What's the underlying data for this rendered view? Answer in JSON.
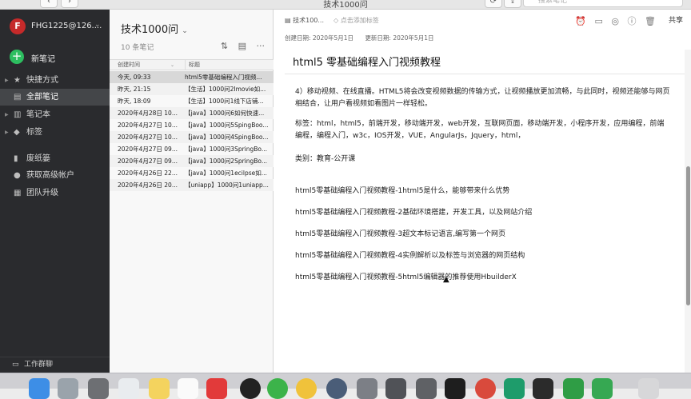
{
  "window": {
    "title": "技术1000问",
    "search_placeholder": "搜索笔记"
  },
  "sidebar": {
    "account": {
      "initial": "F",
      "name": "FHG1225@126...."
    },
    "new_note_label": "新笔记",
    "items": [
      {
        "label": "快捷方式",
        "icon": "star-icon"
      },
      {
        "label": "全部笔记",
        "icon": "note-icon",
        "active": true
      },
      {
        "label": "笔记本",
        "icon": "notebook-icon"
      },
      {
        "label": "标签",
        "icon": "tag-icon"
      },
      {
        "label": "废纸篓",
        "icon": "trash-icon"
      },
      {
        "label": "获取高级帐户",
        "icon": "upgrade-icon"
      },
      {
        "label": "团队升级",
        "icon": "team-icon"
      }
    ],
    "footer_label": "工作群聊"
  },
  "notes_list": {
    "title": "技术1000问",
    "count": "10 条笔记",
    "columns": {
      "created": "创建时间",
      "title": "标题"
    },
    "rows": [
      {
        "date": "今天, 09:33",
        "title": "html5零基础编程入门视频..."
      },
      {
        "date": "昨天, 21:15",
        "title": "【生活】1000问2Imovie如..."
      },
      {
        "date": "昨天, 18:09",
        "title": "【生活】1000问1线下店铺..."
      },
      {
        "date": "2020年4月28日 10...",
        "title": "【java】1000问6如何快速..."
      },
      {
        "date": "2020年4月27日 10...",
        "title": "【java】1000问5SpingBoo..."
      },
      {
        "date": "2020年4月27日 10...",
        "title": "【java】1000问4SpingBoo..."
      },
      {
        "date": "2020年4月27日 09...",
        "title": "【java】1000问3SpringBo..."
      },
      {
        "date": "2020年4月27日 09...",
        "title": "【java】1000问2SpringBo..."
      },
      {
        "date": "2020年4月26日 22...",
        "title": "【java】1000问1ecilpse如..."
      },
      {
        "date": "2020年4月26日 20...",
        "title": "【uniapp】1000问1uniapp..."
      }
    ]
  },
  "note": {
    "notebook": "技术100...",
    "add_tag": "点击添加标签",
    "created": "创建日期: 2020年5月1日",
    "updated": "更新日期: 2020年5月1日",
    "share_label": "共享",
    "title": "html5 零基础编程入门视频教程",
    "paragraph": "4）移动视频、在线直播。HTML5将会改变视频数据的传输方式，让视频播放更加流畅，与此同时，视频还能够与网页相结合，让用户看视频如看图片一样轻松。",
    "tags": "标签：html，html5，前端开发，移动端开发，web开发，互联网页面，移动端开发，小程序开发，应用编程，前端编程，编程入门，w3c，IOS开发，VUE，AngularJs，Jquery，html，",
    "category": "类别：教育-公开课",
    "lessons": [
      "html5零基础编程入门视频教程-1html5是什么，能够带来什么优势",
      "html5零基础编程入门视频教程-2基础环境搭建，开发工具，以及网站介绍",
      "html5零基础编程入门视频教程-3超文本标记语言,编写第一个网页",
      "html5零基础编程入门视频教程-4实例解析以及标签与浏览器的网页结构",
      "html5零基础编程入门视频教程-5html5编辑器的推荐使用HbuilderX"
    ]
  }
}
